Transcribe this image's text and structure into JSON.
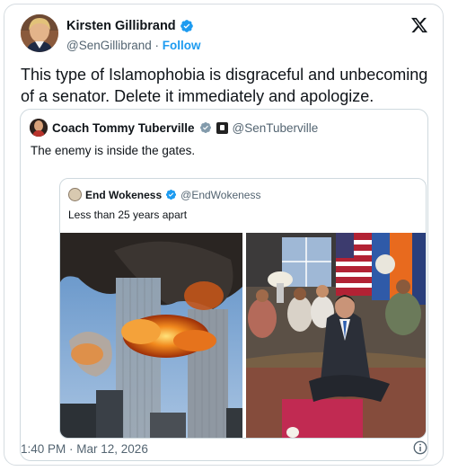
{
  "author": {
    "name": "Kirsten Gillibrand",
    "handle": "@SenGillibrand",
    "separator": "·",
    "follow_label": "Follow"
  },
  "tweet_text": "This type of Islamophobia is disgraceful and unbecoming of a senator. Delete it immediately and apologize.",
  "quoted_tweet": {
    "name": "Coach Tommy Tuberville",
    "handle": "@SenTuberville",
    "text": "The enemy is inside the gates.",
    "nested_quote": {
      "name": "End Wokeness",
      "handle": "@EndWokeness",
      "text": "Less than 25 years apart"
    }
  },
  "timestamp": "1:40 PM · Mar 12, 2026",
  "colors": {
    "accent": "#1d9bf0",
    "text": "#0f1419",
    "muted": "#536471",
    "border": "#cfd9de"
  },
  "icons": [
    "verified-badge-icon",
    "x-logo-icon",
    "government-badge-icon",
    "info-icon"
  ]
}
